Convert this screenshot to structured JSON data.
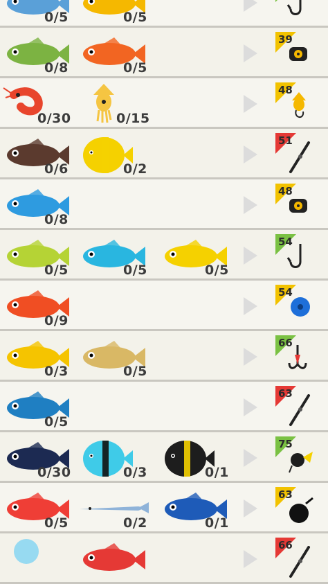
{
  "rows": [
    {
      "fish": [
        {
          "name": "blue-striped-fish",
          "count": "0/5",
          "color": "#5aa0d8"
        },
        {
          "name": "yellow-fish",
          "count": "0/5",
          "color": "#f5b800"
        }
      ],
      "reward": {
        "level": "",
        "badge_color": "#7ac143",
        "item": "hook-icon"
      }
    },
    {
      "fish": [
        {
          "name": "green-trout",
          "count": "0/8",
          "color": "#7cb342"
        },
        {
          "name": "orange-squirrelfish",
          "count": "0/5",
          "color": "#f26522"
        }
      ],
      "reward": {
        "level": "39",
        "badge_color": "#f2c200",
        "item": "reel-icon"
      }
    },
    {
      "fish": [
        {
          "name": "shrimp",
          "count": "0/30",
          "color": "#e8452c"
        },
        {
          "name": "squid",
          "count": "0/15",
          "color": "#f5c542"
        }
      ],
      "reward": {
        "level": "48",
        "badge_color": "#f2c200",
        "item": "squid-lure-icon"
      }
    },
    {
      "fish": [
        {
          "name": "brown-rockfish",
          "count": "0/6",
          "color": "#5b3a2e"
        },
        {
          "name": "moorish-idol",
          "count": "0/2",
          "color": "#f5d100"
        }
      ],
      "reward": {
        "level": "51",
        "badge_color": "#e53935",
        "item": "rod-icon"
      }
    },
    {
      "fish": [
        {
          "name": "blue-tang",
          "count": "0/8",
          "color": "#2e9be0"
        }
      ],
      "reward": {
        "level": "48",
        "badge_color": "#f2c200",
        "item": "reel-icon"
      }
    },
    {
      "fish": [
        {
          "name": "green-striped-fish",
          "count": "0/5",
          "color": "#b5d335"
        },
        {
          "name": "blue-striped-fish",
          "count": "0/5",
          "color": "#29b6e0"
        },
        {
          "name": "butterflyfish",
          "count": "0/5",
          "color": "#f5d100"
        }
      ],
      "reward": {
        "level": "54",
        "badge_color": "#7ac143",
        "item": "hook-icon"
      }
    },
    {
      "fish": [
        {
          "name": "red-goatfish",
          "count": "0/9",
          "color": "#f04e23"
        }
      ],
      "reward": {
        "level": "54",
        "badge_color": "#f2c200",
        "item": "line-spool-icon"
      }
    },
    {
      "fish": [
        {
          "name": "yellow-butterflyfish",
          "count": "0/3",
          "color": "#f5c400"
        },
        {
          "name": "spotted-pufferfish",
          "count": "0/5",
          "color": "#d9b865"
        }
      ],
      "reward": {
        "level": "66",
        "badge_color": "#7ac143",
        "item": "treble-hook-icon"
      }
    },
    {
      "fish": [
        {
          "name": "mahi-mahi",
          "count": "0/5",
          "color": "#1f7fc2"
        }
      ],
      "reward": {
        "level": "63",
        "badge_color": "#e53935",
        "item": "rod-icon"
      }
    },
    {
      "fish": [
        {
          "name": "blue-surgeonfish",
          "count": "0/30",
          "color": "#1c2a52"
        },
        {
          "name": "cyan-angelfish",
          "count": "0/3",
          "color": "#3fcbe8"
        },
        {
          "name": "black-angelfish",
          "count": "0/1",
          "color": "#1d1d1d"
        }
      ],
      "reward": {
        "level": "75",
        "badge_color": "#7ac143",
        "item": "spinner-lure-icon"
      }
    },
    {
      "fish": [
        {
          "name": "red-gurnard",
          "count": "0/5",
          "color": "#ef3e36"
        },
        {
          "name": "needlefish",
          "count": "0/2",
          "color": "#8fb3d9"
        },
        {
          "name": "tuna",
          "count": "0/1",
          "color": "#1e5bb8"
        }
      ],
      "reward": {
        "level": "63",
        "badge_color": "#f2c200",
        "item": "weight-icon"
      }
    },
    {
      "fish": [
        {
          "name": "jellyfish",
          "count": "",
          "color": "#7fd3f3"
        },
        {
          "name": "red-fish",
          "count": "",
          "color": "#e53935"
        }
      ],
      "reward": {
        "level": "66",
        "badge_color": "#e53935",
        "item": "rod-icon"
      }
    }
  ]
}
